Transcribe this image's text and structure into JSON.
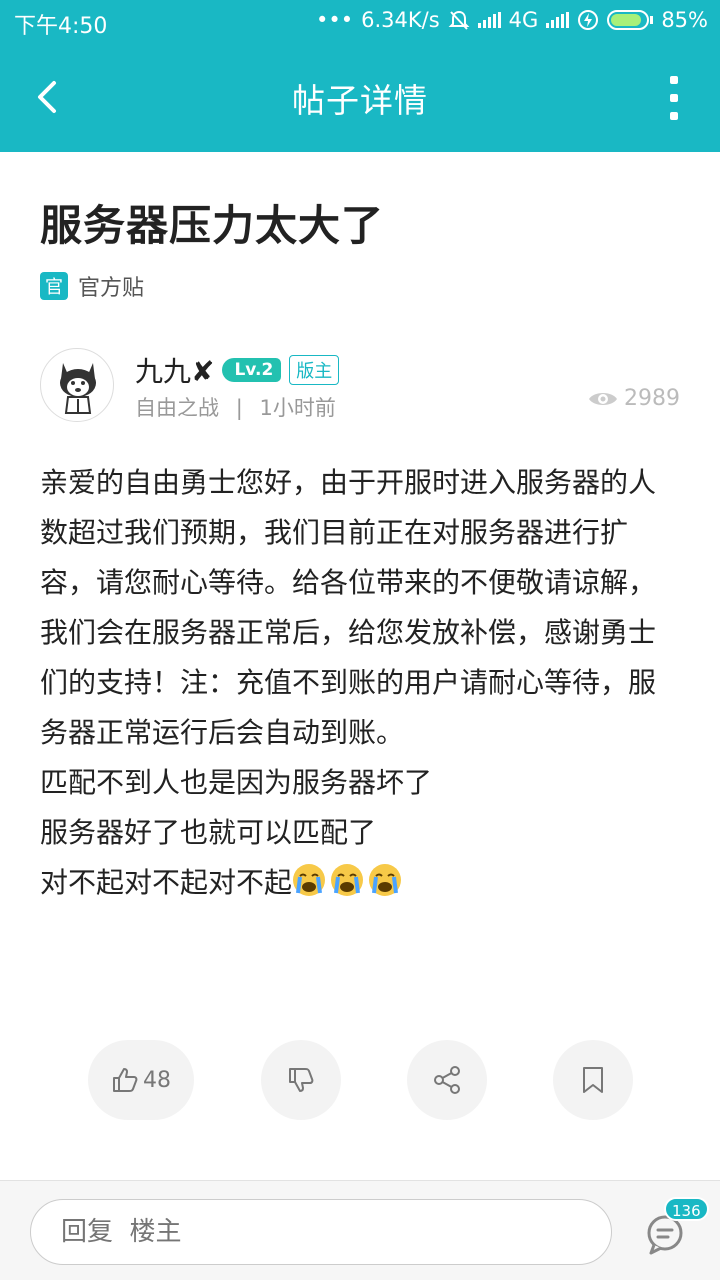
{
  "status_bar": {
    "time": "下午4:50",
    "speed": "6.34K/s",
    "network": "4G",
    "battery": "85%"
  },
  "app_bar": {
    "title": "帖子详情"
  },
  "post": {
    "title": "服务器压力太大了",
    "official_badge": "官",
    "official_label": "官方贴",
    "author": {
      "name": "九九✘",
      "level": "Lv.2",
      "role": "版主",
      "section": "自由之战",
      "separator": "|",
      "time": "1小时前"
    },
    "views": "2989",
    "paragraphs": [
      "亲爱的自由勇士您好，由于开服时进入服务器的人数超过我们预期，我们目前正在对服务器进行扩容，请您耐心等待。给各位带来的不便敬请谅解，我们会在服务器正常后，给您发放补偿，感谢勇士们的支持！注：充值不到账的用户请耐心等待，服务器正常运行后会自动到账。",
      "匹配不到人也是因为服务器坏了",
      "服务器好了也就可以匹配了",
      "对不起对不起对不起"
    ],
    "emoji": "loudly-crying-face"
  },
  "actions": {
    "like_count": "48"
  },
  "reply_bar": {
    "placeholder": "回复  楼主",
    "comment_count": "136"
  },
  "colors": {
    "accent": "#19b8c4",
    "level_badge": "#23c1b0"
  }
}
